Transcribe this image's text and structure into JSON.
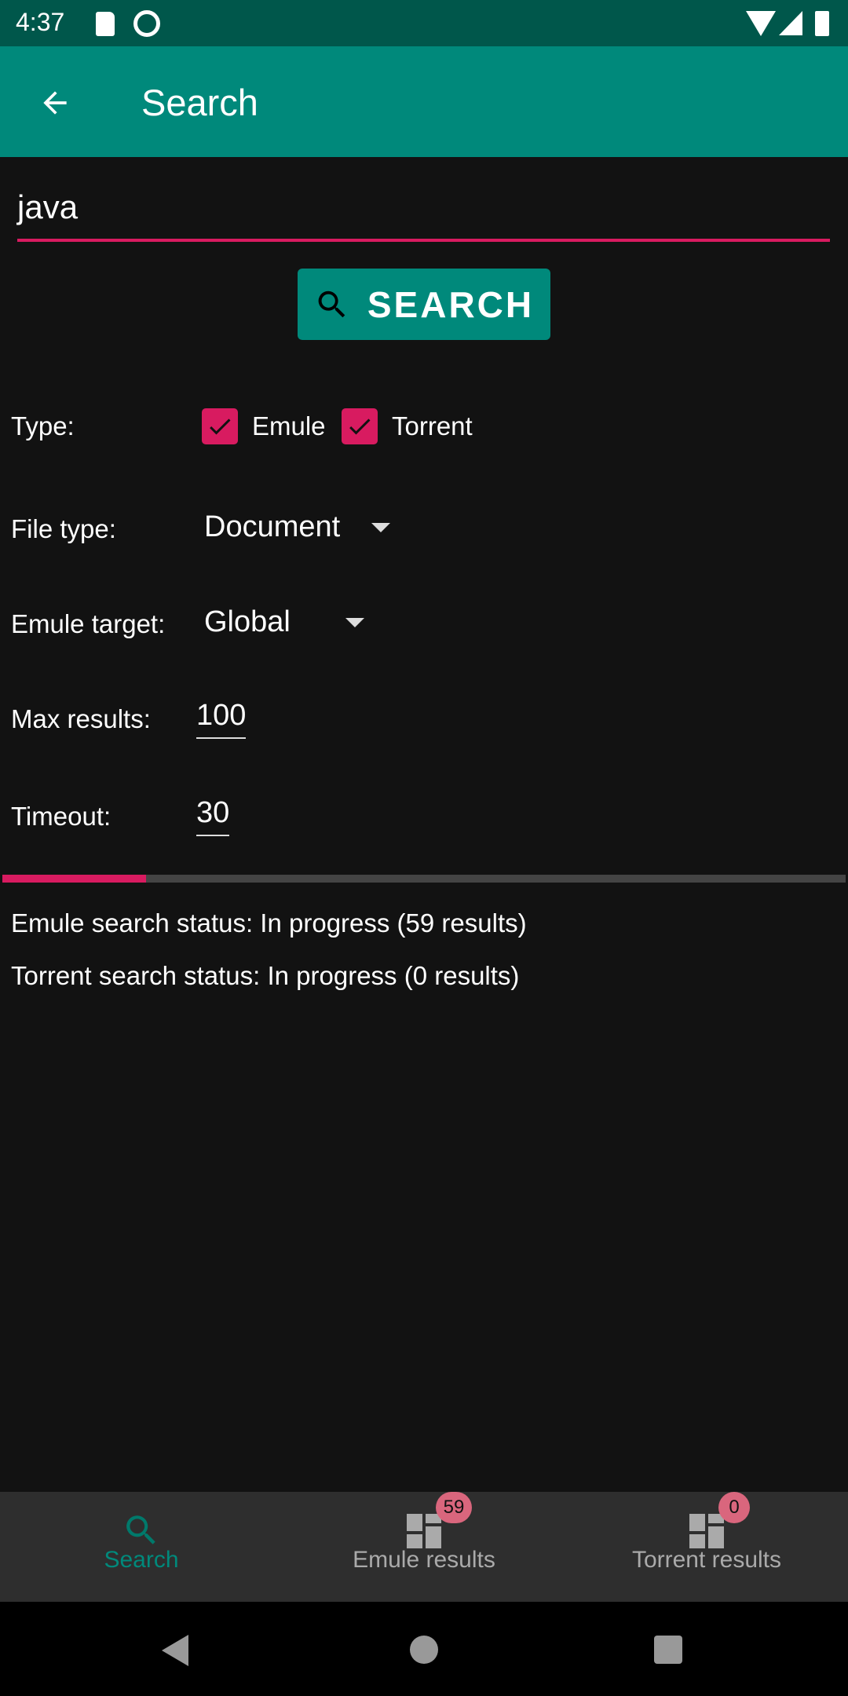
{
  "status_bar": {
    "time": "4:37"
  },
  "app_bar": {
    "title": "Search"
  },
  "search": {
    "query": "java",
    "button_label": "SEARCH"
  },
  "form": {
    "type_label": "Type:",
    "emule_label": "Emule",
    "emule_checked": true,
    "torrent_label": "Torrent",
    "torrent_checked": true,
    "file_type_label": "File type:",
    "file_type_value": "Document",
    "emule_target_label": "Emule target:",
    "emule_target_value": "Global",
    "max_results_label": "Max results:",
    "max_results_value": "100",
    "timeout_label": "Timeout:",
    "timeout_value": "30"
  },
  "progress": {
    "fraction": 0.17
  },
  "statuses": {
    "emule": "Emule search status: In progress (59 results)",
    "torrent": "Torrent search status: In progress (0 results)"
  },
  "bottom_nav": {
    "items": [
      {
        "label": "Search",
        "active": true
      },
      {
        "label": "Emule results",
        "badge": "59"
      },
      {
        "label": "Torrent results",
        "badge": "0"
      }
    ]
  },
  "colors": {
    "primary": "#00897b",
    "primary_dark": "#00574b",
    "accent": "#d81b60"
  }
}
